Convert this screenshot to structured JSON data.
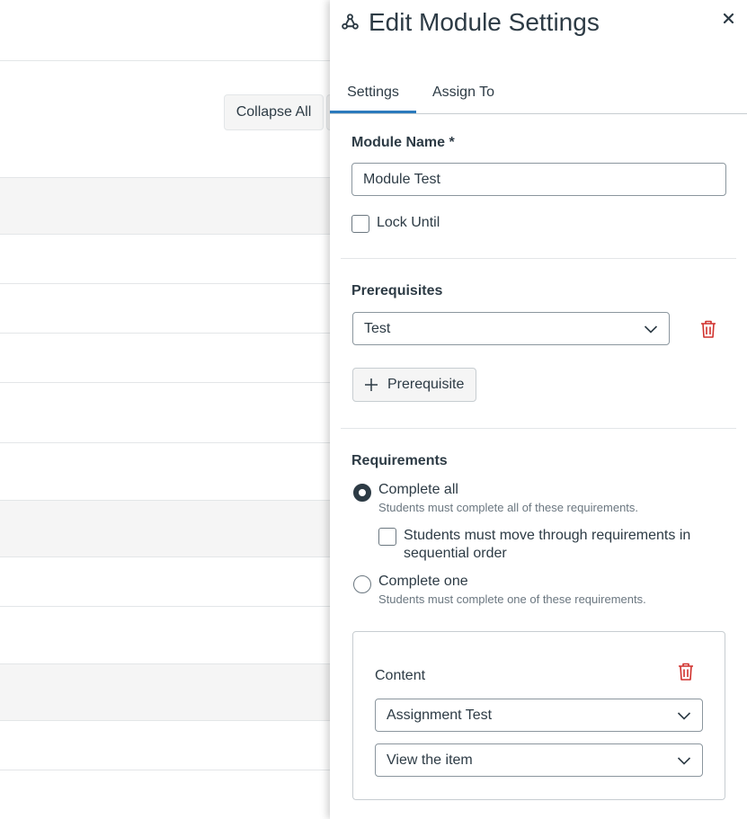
{
  "background": {
    "collapse_all_label": "Collapse All"
  },
  "tray": {
    "title": "Edit Module Settings",
    "tabs": [
      {
        "label": "Settings",
        "selected": true
      },
      {
        "label": "Assign To",
        "selected": false
      }
    ],
    "accent_color": "#2b7abc",
    "danger_color": "#d0312d",
    "settings": {
      "module_name_label": "Module Name *",
      "module_name_value": "Module Test",
      "lock_until_label": "Lock Until",
      "lock_until_checked": false,
      "prerequisites_label": "Prerequisites",
      "prerequisite_selected": "Test",
      "add_prerequisite_label": "Prerequisite",
      "requirements_label": "Requirements",
      "requirement_options": [
        {
          "label": "Complete all",
          "hint": "Students must complete all of these requirements.",
          "selected": true
        },
        {
          "label": "Complete one",
          "hint": "Students must complete one of these requirements.",
          "selected": false
        }
      ],
      "sequential_label": "Students must move through requirements in sequential order",
      "sequential_checked": false,
      "requirement_item": {
        "content_label": "Content",
        "content_selected": "Assignment Test",
        "action_selected": "View the item"
      }
    }
  }
}
